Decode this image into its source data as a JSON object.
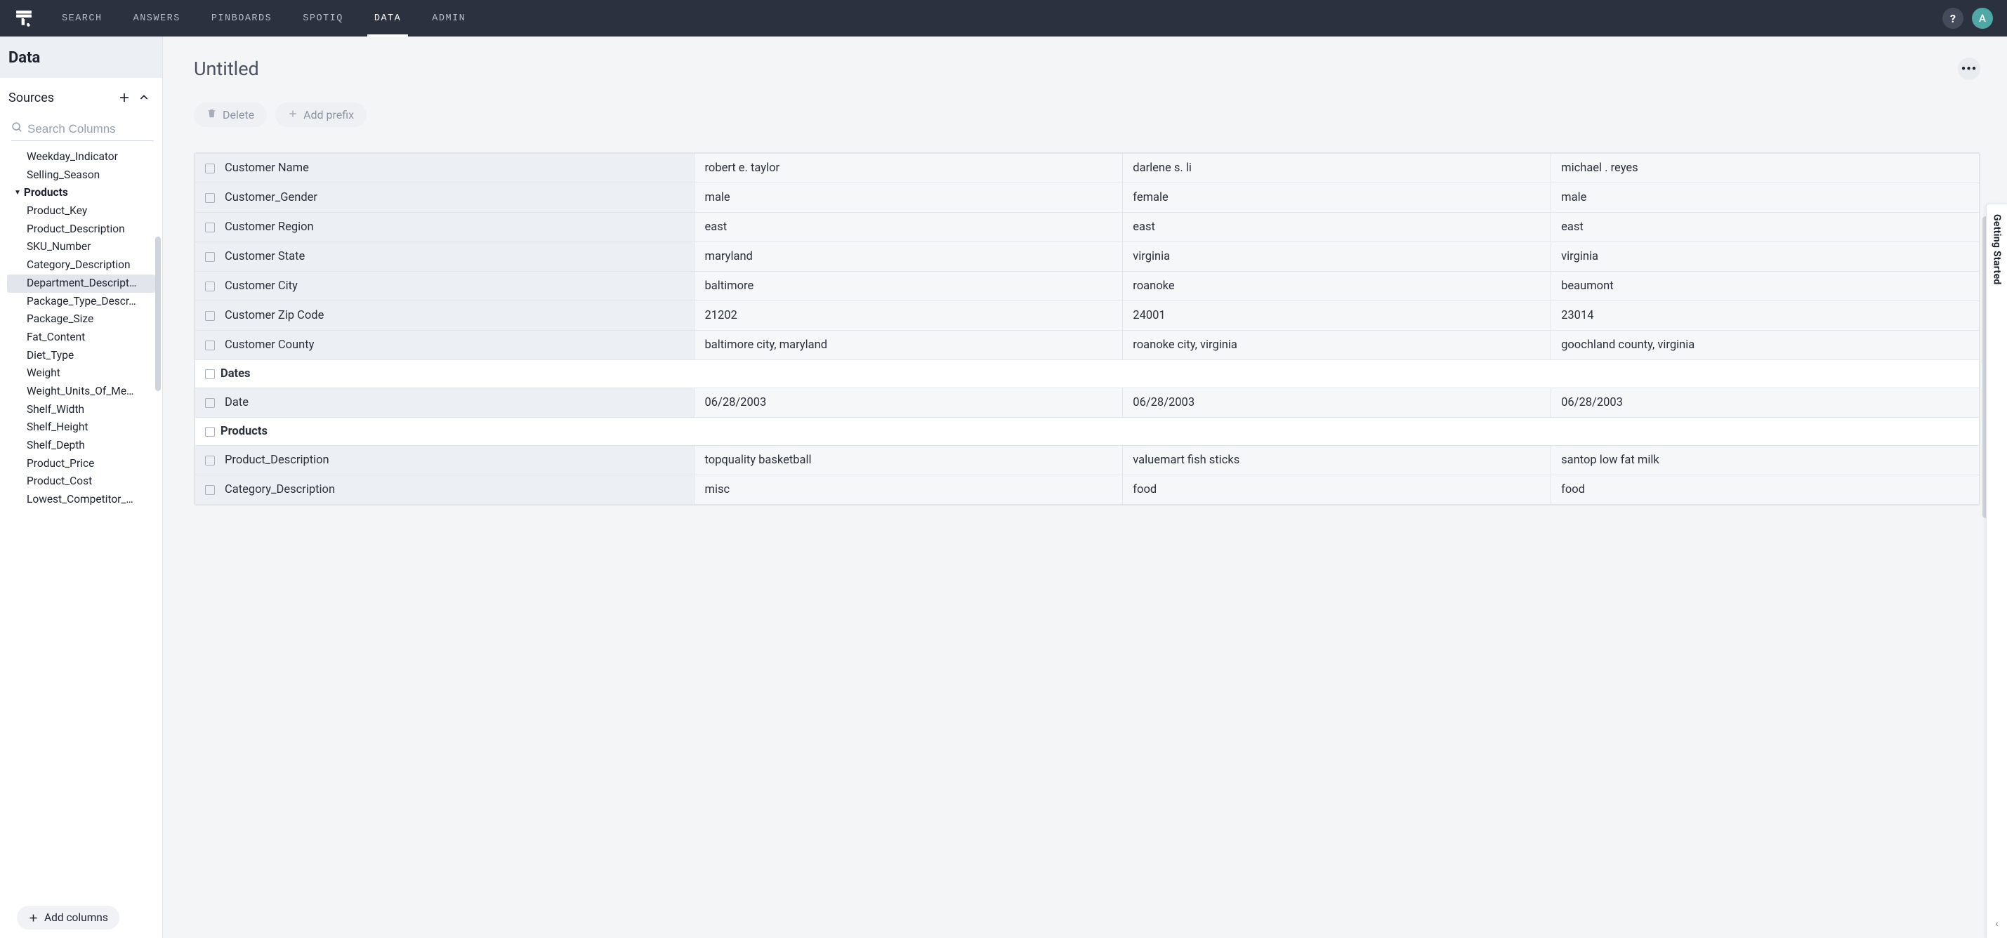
{
  "nav": {
    "items": [
      "SEARCH",
      "ANSWERS",
      "PINBOARDS",
      "SPOTIQ",
      "DATA",
      "ADMIN"
    ],
    "active_index": 4,
    "avatar_initial": "A",
    "help_symbol": "?"
  },
  "sidebar": {
    "header": "Data",
    "sources_label": "Sources",
    "search_placeholder": "Search Columns",
    "add_columns_label": "Add columns",
    "tree": [
      {
        "label": "Weekday_Indicator",
        "type": "item"
      },
      {
        "label": "Selling_Season",
        "type": "item"
      },
      {
        "label": "Products",
        "type": "group"
      },
      {
        "label": "Product_Key",
        "type": "item"
      },
      {
        "label": "Product_Description",
        "type": "item"
      },
      {
        "label": "SKU_Number",
        "type": "item"
      },
      {
        "label": "Category_Description",
        "type": "item"
      },
      {
        "label": "Department_Descript…",
        "type": "item",
        "selected": true
      },
      {
        "label": "Package_Type_Descr…",
        "type": "item"
      },
      {
        "label": "Package_Size",
        "type": "item"
      },
      {
        "label": "Fat_Content",
        "type": "item"
      },
      {
        "label": "Diet_Type",
        "type": "item"
      },
      {
        "label": "Weight",
        "type": "item"
      },
      {
        "label": "Weight_Units_Of_Me…",
        "type": "item"
      },
      {
        "label": "Shelf_Width",
        "type": "item"
      },
      {
        "label": "Shelf_Height",
        "type": "item"
      },
      {
        "label": "Shelf_Depth",
        "type": "item"
      },
      {
        "label": "Product_Price",
        "type": "item"
      },
      {
        "label": "Product_Cost",
        "type": "item"
      },
      {
        "label": "Lowest_Competitor_…",
        "type": "item"
      }
    ]
  },
  "main": {
    "title": "Untitled",
    "delete_label": "Delete",
    "add_prefix_label": "Add prefix",
    "sections": [
      {
        "rows": [
          {
            "label": "Customer Name",
            "values": [
              "robert e. taylor",
              "darlene s. li",
              "michael . reyes"
            ]
          },
          {
            "label": "Customer_Gender",
            "values": [
              "male",
              "female",
              "male"
            ]
          },
          {
            "label": "Customer Region",
            "values": [
              "east",
              "east",
              "east"
            ]
          },
          {
            "label": "Customer State",
            "values": [
              "maryland",
              "virginia",
              "virginia"
            ]
          },
          {
            "label": "Customer City",
            "values": [
              "baltimore",
              "roanoke",
              "beaumont"
            ]
          },
          {
            "label": "Customer Zip Code",
            "values": [
              "21202",
              "24001",
              "23014"
            ]
          },
          {
            "label": "Customer County",
            "values": [
              "baltimore city, maryland",
              "roanoke city, virginia",
              "goochland county, virginia"
            ]
          }
        ]
      },
      {
        "title": "Dates",
        "rows": [
          {
            "label": "Date",
            "values": [
              "06/28/2003",
              "06/28/2003",
              "06/28/2003"
            ]
          }
        ]
      },
      {
        "title": "Products",
        "rows": [
          {
            "label": "Product_Description",
            "values": [
              "topquality basketball",
              "valuemart fish sticks",
              "santop low fat milk"
            ]
          },
          {
            "label": "Category_Description",
            "values": [
              "misc",
              "food",
              "food"
            ]
          }
        ]
      }
    ]
  },
  "rail": {
    "label": "Getting Started"
  }
}
